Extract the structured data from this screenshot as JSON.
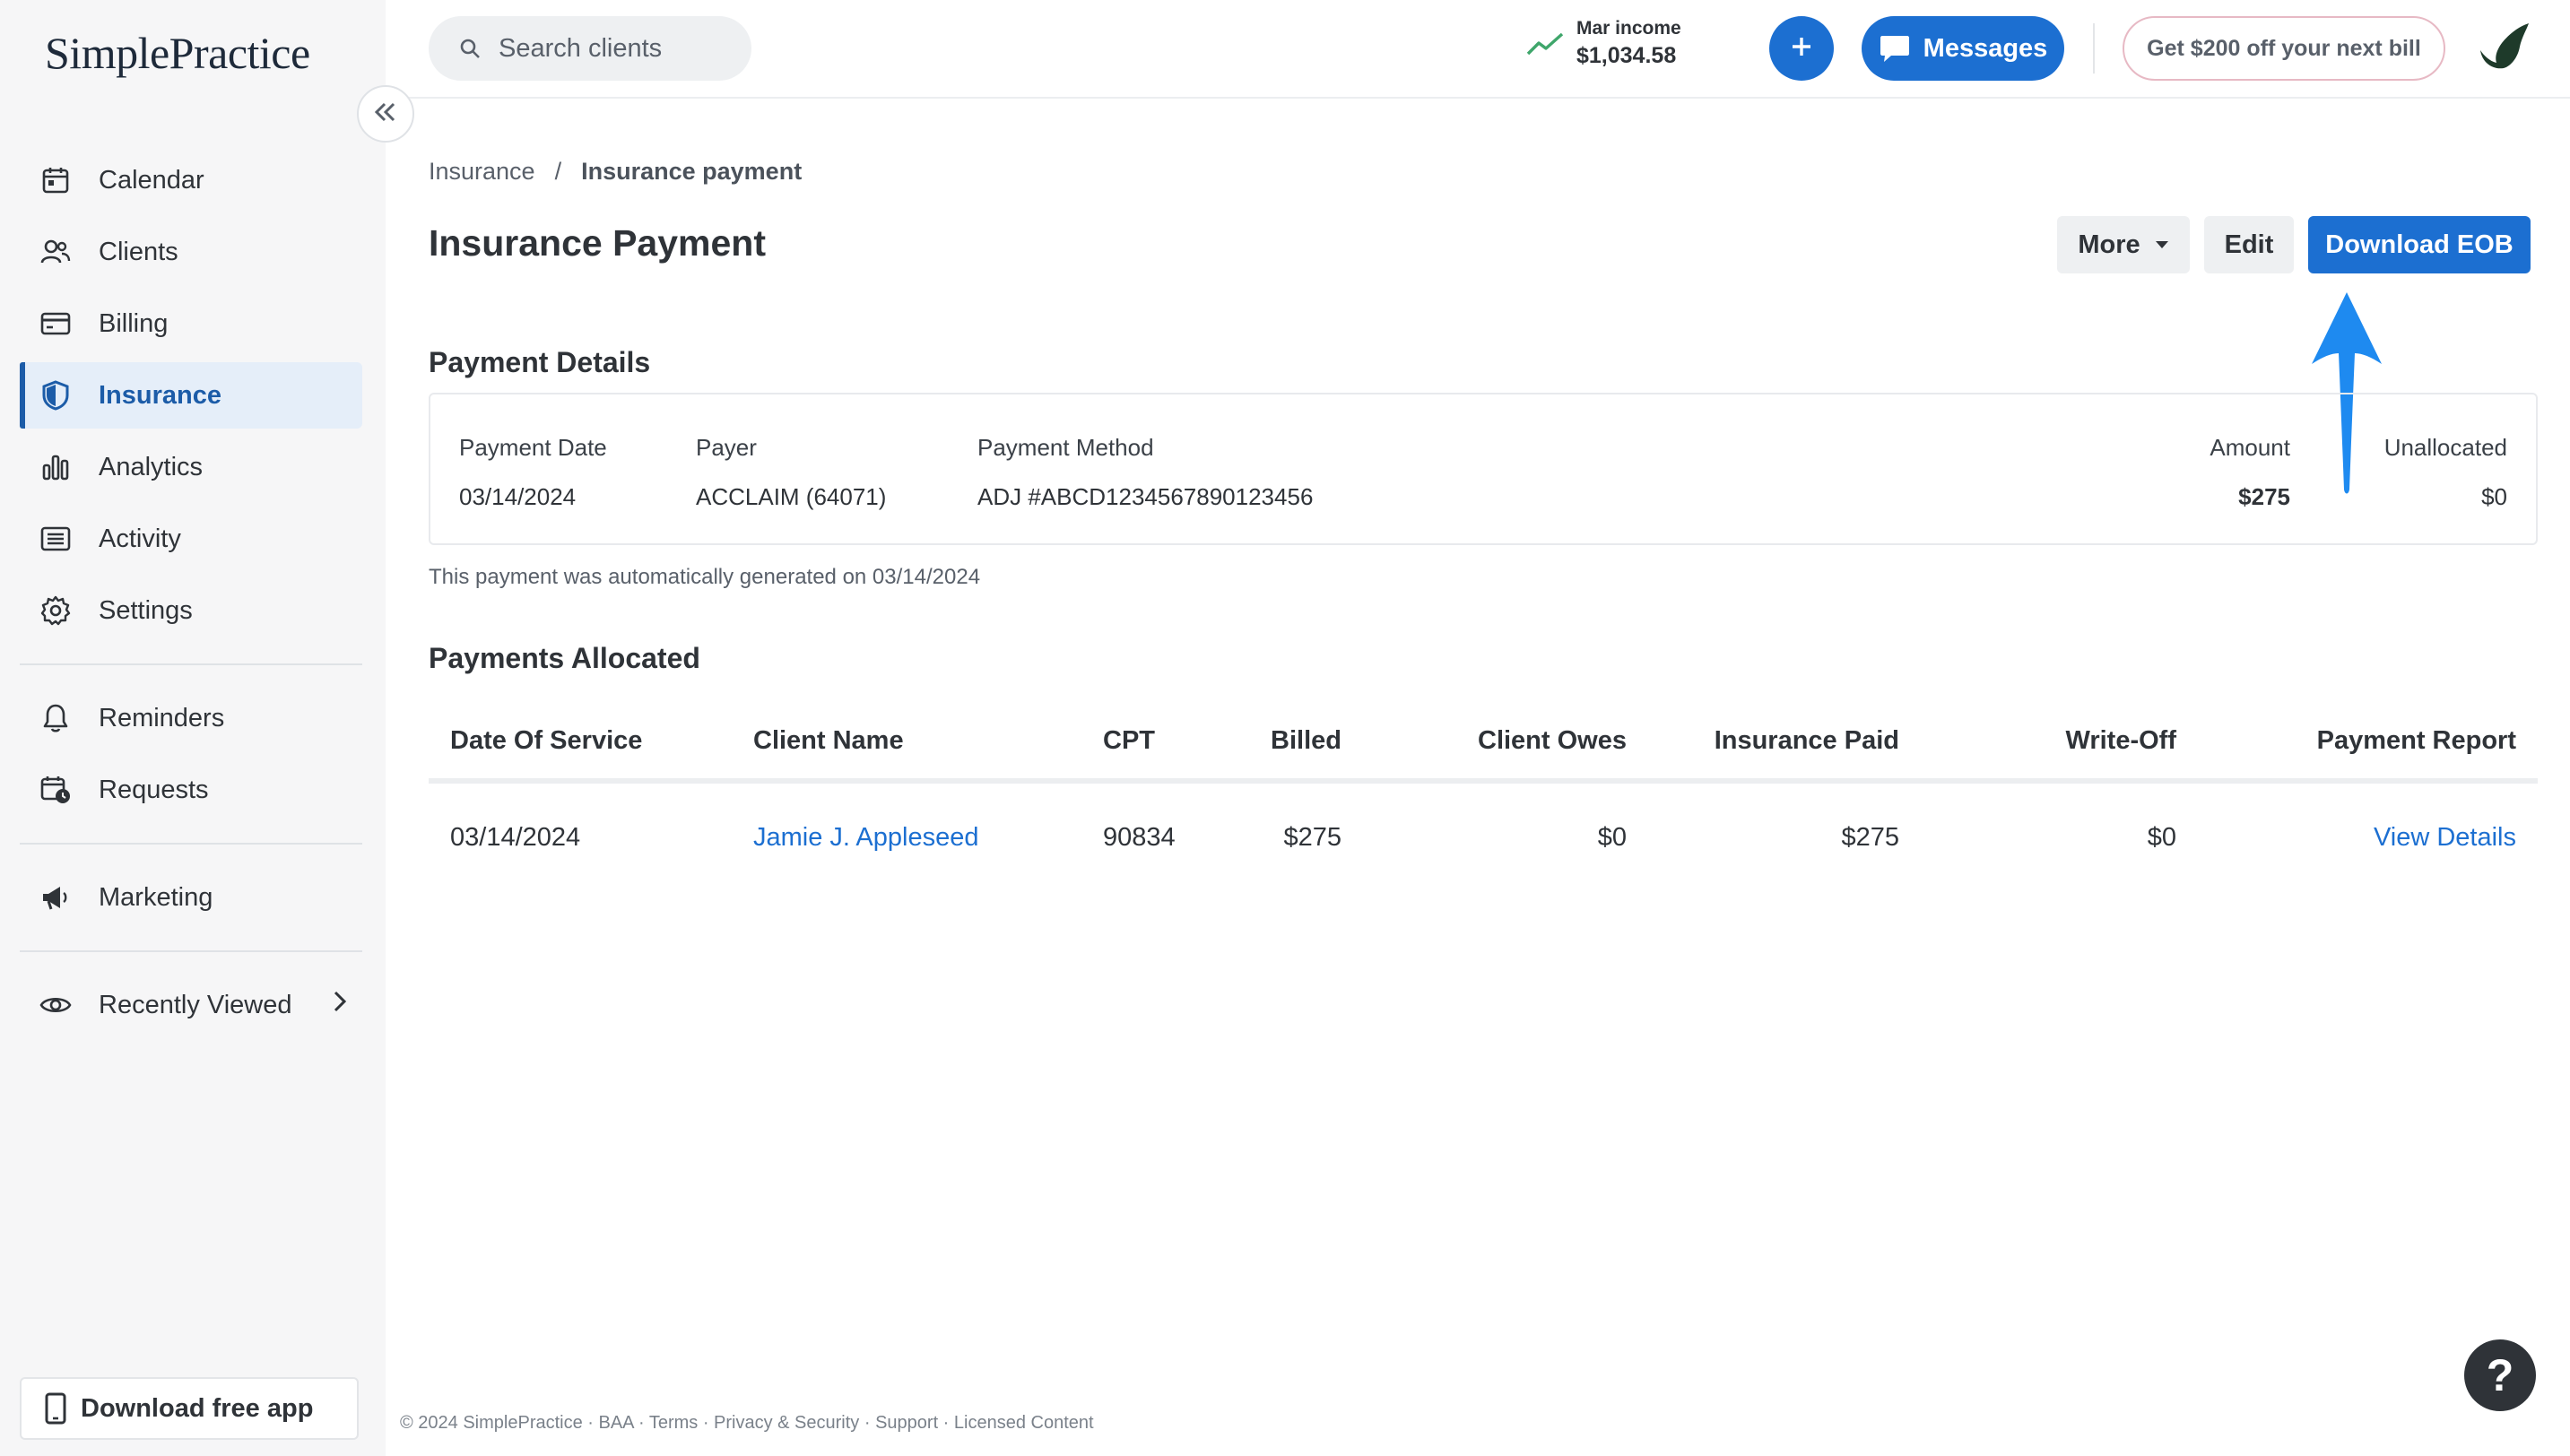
{
  "app": {
    "logo": "SimplePractice"
  },
  "sidebar": {
    "items": [
      {
        "label": "Calendar",
        "icon": "calendar-icon"
      },
      {
        "label": "Clients",
        "icon": "clients-icon"
      },
      {
        "label": "Billing",
        "icon": "billing-icon"
      },
      {
        "label": "Insurance",
        "icon": "shield-icon",
        "active": true
      },
      {
        "label": "Analytics",
        "icon": "analytics-icon"
      },
      {
        "label": "Activity",
        "icon": "activity-icon"
      },
      {
        "label": "Settings",
        "icon": "gear-icon"
      }
    ],
    "secondary": [
      {
        "label": "Reminders",
        "icon": "bell-icon"
      },
      {
        "label": "Requests",
        "icon": "requests-icon"
      }
    ],
    "marketing": {
      "label": "Marketing",
      "icon": "megaphone-icon"
    },
    "recently_viewed": {
      "label": "Recently Viewed",
      "icon": "eye-icon"
    },
    "download_app": "Download free app"
  },
  "topbar": {
    "search_placeholder": "Search clients",
    "income_label": "Mar income",
    "income_value": "$1,034.58",
    "messages_label": "Messages",
    "promo_label": "Get $200 off your next bill"
  },
  "breadcrumb": {
    "parent": "Insurance",
    "separator": "/",
    "current": "Insurance payment"
  },
  "page": {
    "title": "Insurance Payment",
    "actions": {
      "more": "More",
      "edit": "Edit",
      "download": "Download EOB"
    }
  },
  "payment_details": {
    "title": "Payment Details",
    "payment_date_label": "Payment Date",
    "payment_date": "03/14/2024",
    "payer_label": "Payer",
    "payer": "ACCLAIM (64071)",
    "method_label": "Payment Method",
    "method": "ADJ #ABCD1234567890123456",
    "amount_label": "Amount",
    "amount": "$275",
    "unallocated_label": "Unallocated",
    "unallocated": "$0",
    "note": "This payment was automatically generated on 03/14/2024"
  },
  "allocated": {
    "title": "Payments Allocated",
    "columns": [
      "Date Of Service",
      "Client Name",
      "CPT",
      "Billed",
      "Client Owes",
      "Insurance Paid",
      "Write-Off",
      "Payment Report"
    ],
    "rows": [
      {
        "date": "03/14/2024",
        "client": "Jamie J. Appleseed",
        "cpt": "90834",
        "billed": "$275",
        "client_owes": "$0",
        "insurance_paid": "$275",
        "write_off": "$0",
        "report": "View Details"
      }
    ]
  },
  "footer": "© 2024 SimplePractice · BAA · Terms · Privacy & Security · Support · Licensed Content",
  "help": "?",
  "colors": {
    "primary": "#1c6fd1",
    "annotation_arrow": "#1e8af0",
    "active_nav_bg": "#e5eef9"
  }
}
